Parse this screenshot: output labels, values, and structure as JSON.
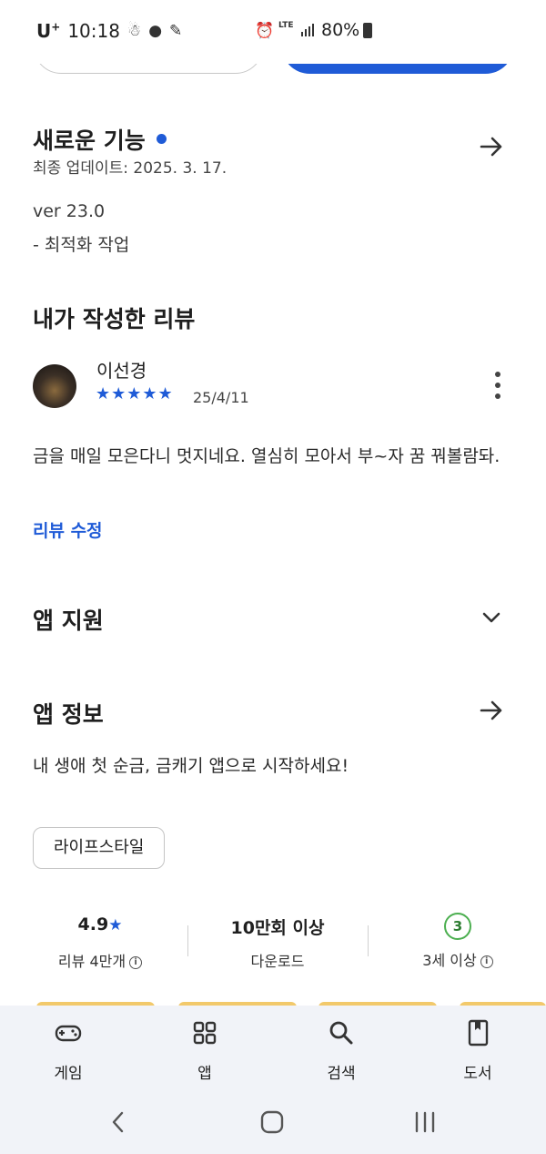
{
  "status_bar": {
    "carrier": "U",
    "carrier_sup": "+",
    "time": "10:18",
    "network": "LTE",
    "battery": "80%"
  },
  "whats_new": {
    "title": "새로운 기능",
    "updated": "최종 업데이트: 2025. 3. 17.",
    "version": "ver 23.0",
    "note": "- 최적화 작업"
  },
  "my_review": {
    "title": "내가 작성한 리뷰",
    "reviewer": "이선경",
    "stars": "★★★★★",
    "rating": 5,
    "date": "25/4/11",
    "body": "금을 매일 모은다니 멋지네요. 열심히 모아서 부~자 꿈 꿔볼람돠.",
    "edit_label": "리뷰 수정"
  },
  "app_support": {
    "title": "앱 지원"
  },
  "app_info": {
    "title": "앱 정보",
    "description": "내 생애 첫 순금, 금캐기 앱으로 시작하세요!",
    "category_chip": "라이프스타일"
  },
  "stats": {
    "rating_value": "4.9",
    "rating_star": "★",
    "rating_label": "리뷰 4만개",
    "downloads_value": "10만회 이상",
    "downloads_label": "다운로드",
    "age_value": "3",
    "age_label": "3세 이상"
  },
  "bottom_nav": {
    "items": [
      {
        "label": "게임",
        "icon": "gamepad-icon"
      },
      {
        "label": "앱",
        "icon": "apps-grid-icon"
      },
      {
        "label": "검색",
        "icon": "search-icon"
      },
      {
        "label": "도서",
        "icon": "book-icon"
      }
    ]
  },
  "colors": {
    "accent": "#1f5bd7",
    "age_badge": "#4caf50",
    "nav_bg": "#f1f3f8"
  }
}
